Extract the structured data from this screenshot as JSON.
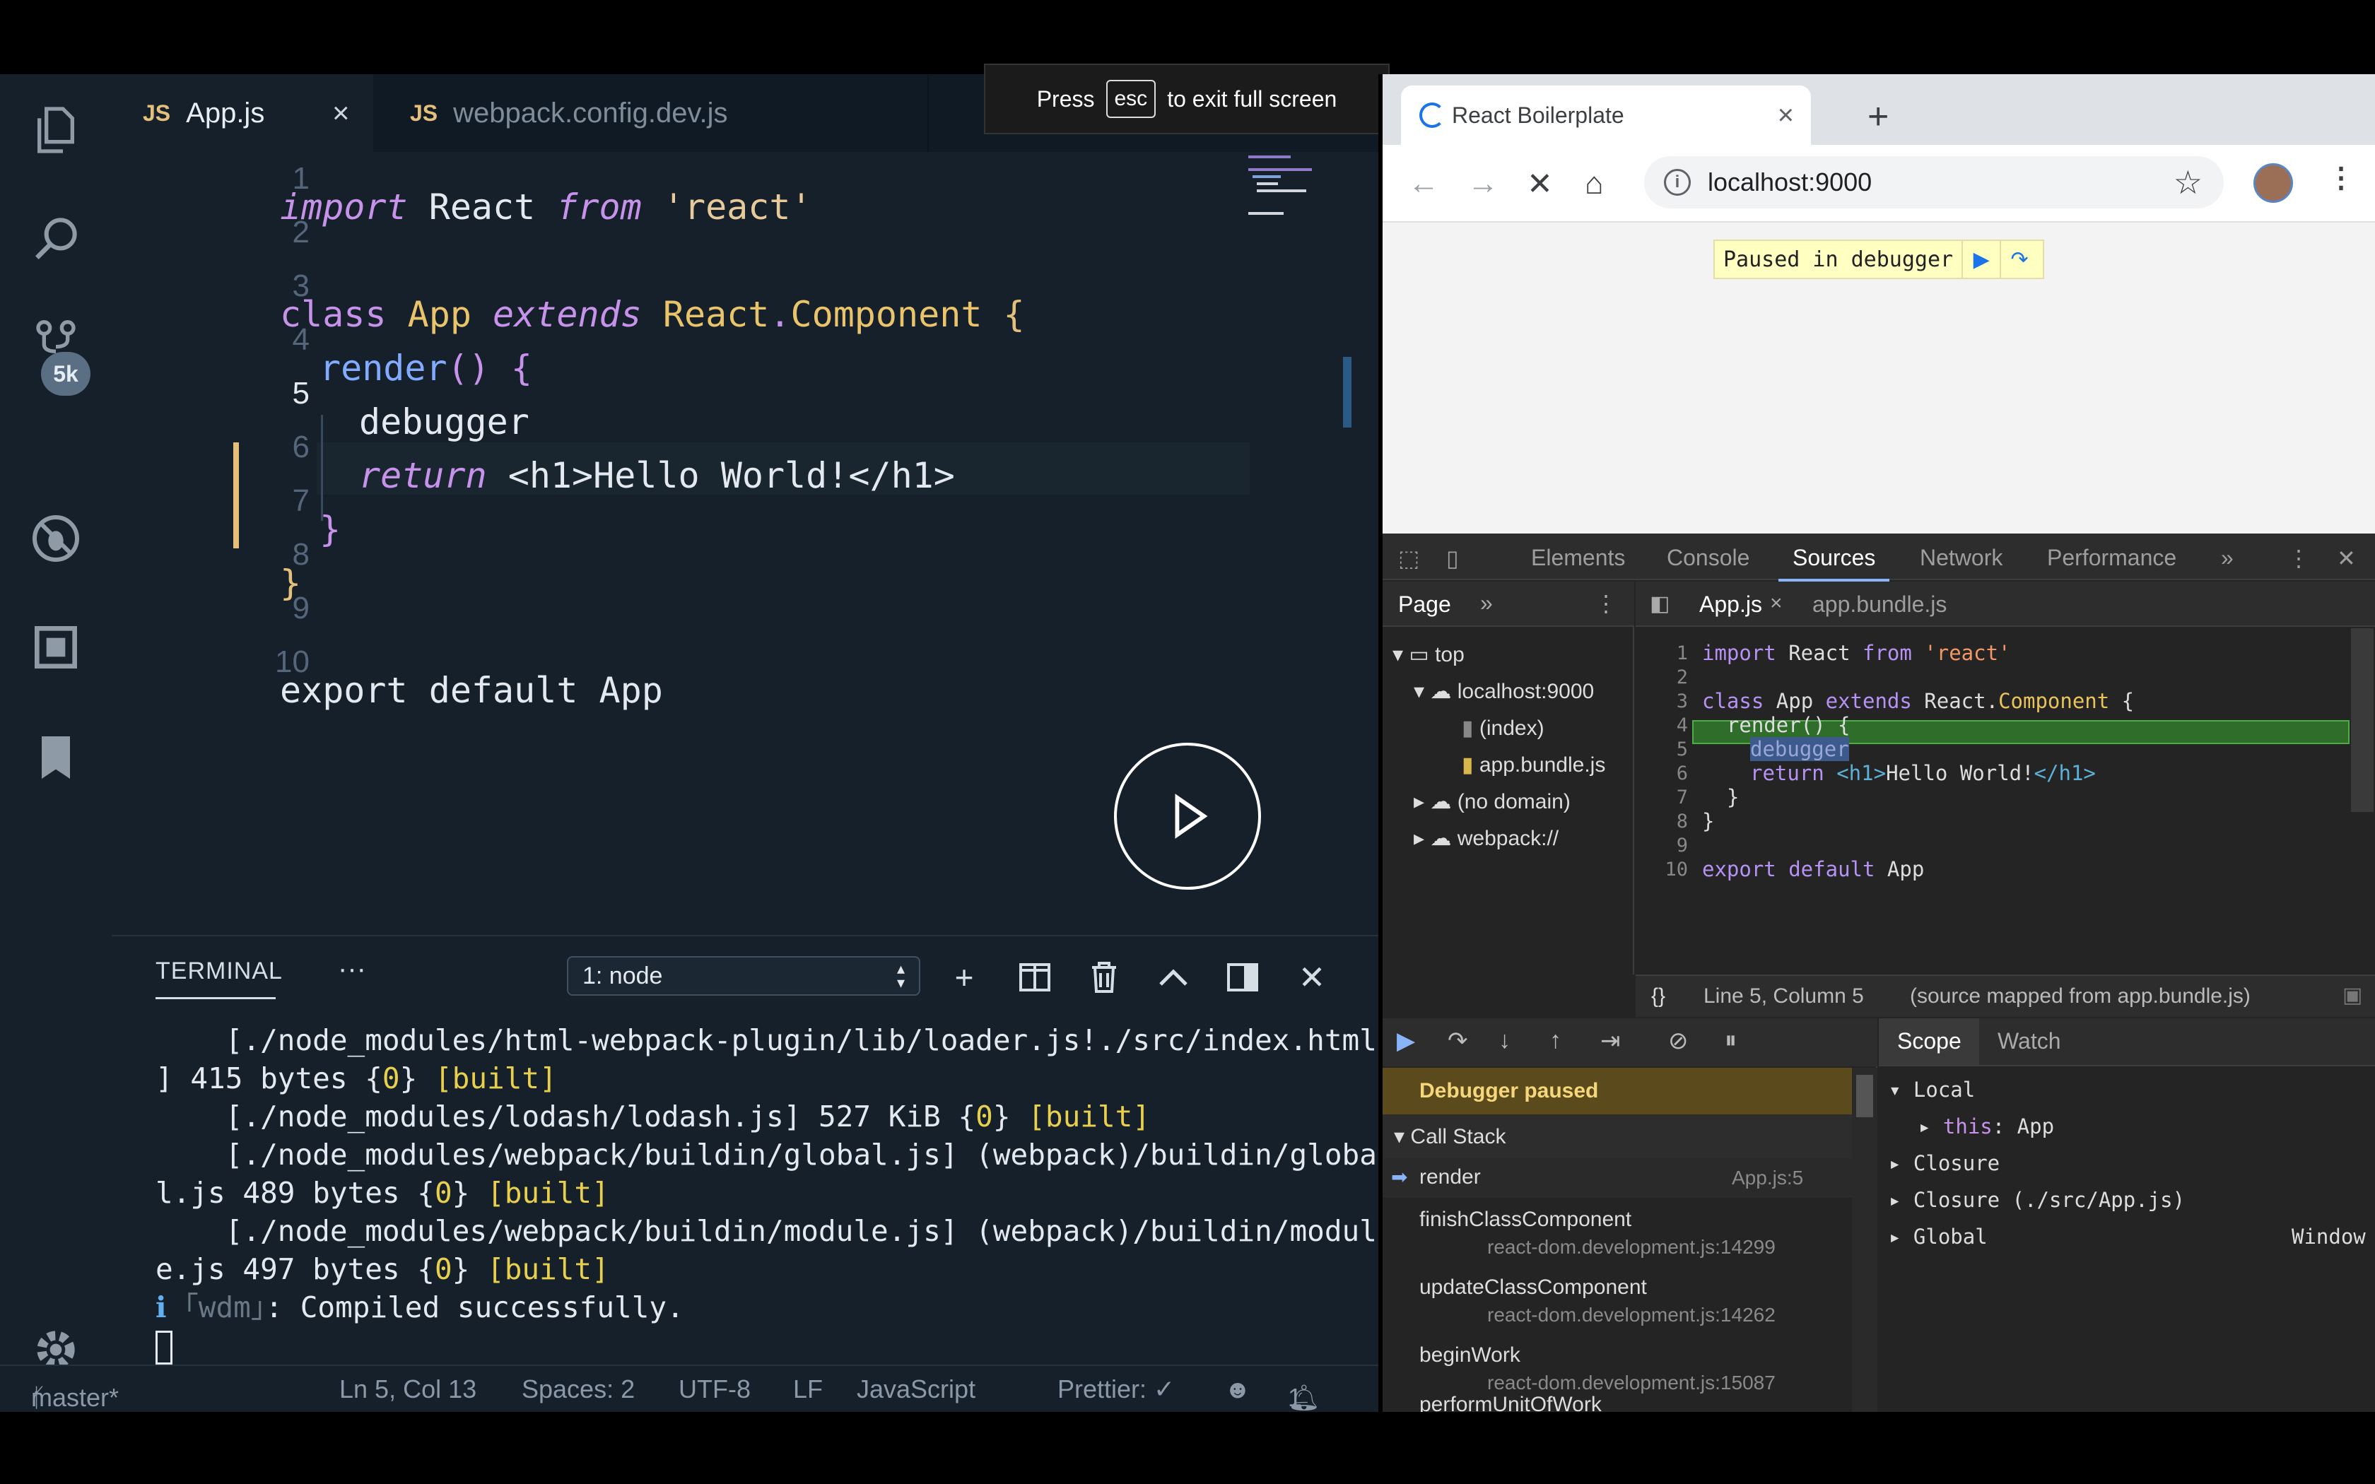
{
  "vscode": {
    "badge": "5k",
    "tabs": [
      {
        "icon": "JS",
        "label": "App.js",
        "close": "×"
      },
      {
        "icon": "JS",
        "label": "webpack.config.dev.js"
      }
    ],
    "line_numbers": [
      "1",
      "2",
      "3",
      "4",
      "5",
      "6",
      "7",
      "8",
      "9",
      "10"
    ],
    "code": {
      "l1": {
        "a": "import",
        "b": " React ",
        "c": "from",
        "d": " 'react'"
      },
      "l3": {
        "a": "class ",
        "b": "App",
        "c": " extends ",
        "d": "React",
        "e": ".",
        "f": "Component",
        "g": " {"
      },
      "l4": {
        "a": "render",
        "b": "() {"
      },
      "l5": {
        "a": "debugger"
      },
      "l6": {
        "a": "return",
        "b": " <h1>Hello World!</h1>"
      },
      "l7": {
        "a": "}"
      },
      "l8": {
        "a": "}"
      },
      "l10": {
        "a": "export default App"
      }
    },
    "fullscreen": {
      "press": "Press",
      "key": "esc",
      "rest": "to exit full screen"
    },
    "terminal": {
      "title": "TERMINAL",
      "more": "···",
      "select": "1: node",
      "lines": {
        "t1": "    [./node_modules/html-webpack-plugin/lib/loader.js!./src/index.html",
        "t2a": "] 415 bytes {",
        "t2b": "0",
        "t2c": "} ",
        "t2d": "[built]",
        "t3a": "    [./node_modules/lodash/lodash.js] 527 KiB {",
        "t3b": "0",
        "t3c": "} ",
        "t3d": "[built]",
        "t4": "    [./node_modules/webpack/buildin/global.js] (webpack)/buildin/globa",
        "t5a": "l.js 489 bytes {",
        "t5b": "0",
        "t5c": "} ",
        "t5d": "[built]",
        "t6": "    [./node_modules/webpack/buildin/module.js] (webpack)/buildin/modul",
        "t7a": "e.js 497 bytes {",
        "t7b": "0",
        "t7c": "} ",
        "t7d": "[built]",
        "t8a": "ℹ",
        "t8b": " ｢wdm｣",
        "t8c": ": Compiled successfully."
      }
    },
    "status": {
      "branch": "master*",
      "position": "Ln 5, Col 13",
      "spaces": "Spaces: 2",
      "encoding": "UTF-8",
      "eol": "LF",
      "language": "JavaScript",
      "prettier": "Prettier: ✓",
      "bell_count": "1"
    }
  },
  "chrome": {
    "tab_title": "React Boilerplate",
    "tab_close": "×",
    "new_tab": "+",
    "url": "localhost:9000",
    "paused_label": "Paused in debugger",
    "devtools": {
      "tabs": [
        "Elements",
        "Console",
        "Sources",
        "Network",
        "Performance"
      ],
      "more": "»",
      "nav": {
        "page_tab": "Page",
        "more": "»",
        "tree": [
          "top",
          "localhost:9000",
          "(index)",
          "app.bundle.js",
          "(no domain)",
          "webpack://"
        ]
      },
      "editor": {
        "tab_active": "App.js",
        "tab_close": "×",
        "tab_other": "app.bundle.js",
        "line_numbers": [
          "1",
          "2",
          "3",
          "4",
          "5",
          "6",
          "7",
          "8",
          "9",
          "10"
        ],
        "l1": {
          "a": "import",
          "b": " React ",
          "c": "from",
          "d": " 'react'"
        },
        "l3": {
          "a": "class",
          "b": " App ",
          "c": "extends",
          "d": " React.",
          "e": "Component",
          "f": " {"
        },
        "l4": {
          "a": "  render() {"
        },
        "l5": {
          "a": "debugger"
        },
        "l6": {
          "a": "return",
          "b": " <h1>",
          "c": "Hello World!",
          "d": "</h1>"
        },
        "l7": {
          "a": "  }"
        },
        "l8": {
          "a": "}"
        },
        "l10": {
          "a": "export",
          "b": " default ",
          "c": "App"
        },
        "footer_braces": "{}",
        "footer_position": "Line 5, Column 5",
        "footer_source": "(source mapped from app.bundle.js)"
      },
      "debugger": {
        "paused": "Debugger paused",
        "call_stack": "Call Stack",
        "frames": [
          {
            "fn": "render",
            "loc": "App.js:5"
          },
          {
            "fn": "finishClassComponent",
            "loc": "react-dom.development.js:14299"
          },
          {
            "fn": "updateClassComponent",
            "loc": "react-dom.development.js:14262"
          },
          {
            "fn": "beginWork",
            "loc": "react-dom.development.js:15087"
          },
          {
            "fn": "performUnitOfWork",
            "loc": ""
          }
        ]
      },
      "scope": {
        "tabs": [
          "Scope",
          "Watch"
        ],
        "local": "Local",
        "this_key": "this",
        "this_val": ": App",
        "closure": "Closure",
        "closure_src": "Closure (./src/App.js)",
        "global": "Global",
        "global_val": "Window"
      }
    }
  },
  "colors": {
    "vscode_bg": "#15202b",
    "accent": "#8ab4f8",
    "debug_highlight": "#2f6d2a",
    "paused_banner": "#ffffc2"
  }
}
